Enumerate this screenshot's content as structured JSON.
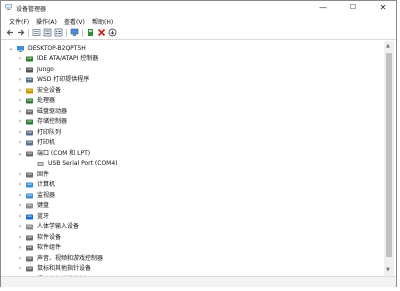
{
  "window": {
    "title": "设备管理器",
    "controls": {
      "minimize": "—",
      "maximize": "☐",
      "close": "✕"
    }
  },
  "menu": [
    "文件(F)",
    "操作(A)",
    "查看(V)",
    "帮助(H)"
  ],
  "colors": {
    "accent": "#0a64ad",
    "selection": "#cce8ff"
  },
  "tree": {
    "root": "DESKTOP-B2QPT5H",
    "items": [
      {
        "label": "IDE ATA/ATAPI 控制器",
        "icon": "ide-controller-icon",
        "color": "#2e7d32"
      },
      {
        "label": "Jungo",
        "icon": "usb-device-icon",
        "color": "#555555"
      },
      {
        "label": "WSD 打印提供程序",
        "icon": "printer-icon",
        "color": "#5a6f8a"
      },
      {
        "label": "安全设备",
        "icon": "security-icon",
        "color": "#c79a00"
      },
      {
        "label": "处理器",
        "icon": "processor-icon",
        "color": "#3a7d3a"
      },
      {
        "label": "磁盘驱动器",
        "icon": "disk-drive-icon",
        "color": "#6d6d6d"
      },
      {
        "label": "存储控制器",
        "icon": "storage-controller-icon",
        "color": "#2e7d32"
      },
      {
        "label": "打印队列",
        "icon": "print-queue-icon",
        "color": "#5a6f8a"
      },
      {
        "label": "打印机",
        "icon": "printer-icon",
        "color": "#5a6f8a"
      },
      {
        "label": "端口 (COM 和 LPT)",
        "icon": "port-icon",
        "color": "#6d6d6d",
        "expanded": true,
        "children": [
          "USB Serial Port (COM4)"
        ]
      },
      {
        "label": "固件",
        "icon": "firmware-icon",
        "color": "#6d6d6d"
      },
      {
        "label": "计算机",
        "icon": "computer-icon",
        "color": "#3a8fd6"
      },
      {
        "label": "监视器",
        "icon": "monitor-icon",
        "color": "#3a8fd6"
      },
      {
        "label": "键盘",
        "icon": "keyboard-icon",
        "color": "#8a8a8a"
      },
      {
        "label": "蓝牙",
        "icon": "bluetooth-icon",
        "color": "#1e6fd0"
      },
      {
        "label": "人体学输入设备",
        "icon": "hid-icon",
        "color": "#8a8a8a"
      },
      {
        "label": "软件设备",
        "icon": "software-device-icon",
        "color": "#6d6d6d"
      },
      {
        "label": "软件组件",
        "icon": "software-component-icon",
        "color": "#6d6d6d"
      },
      {
        "label": "声音、视频和游戏控制器",
        "icon": "audio-icon",
        "color": "#6d6d6d"
      },
      {
        "label": "鼠标和其他指针设备",
        "icon": "mouse-icon",
        "color": "#6d6d6d"
      },
      {
        "label": "通用串行总线控制器",
        "icon": "usb-controller-icon",
        "color": "#6d6d6d"
      }
    ]
  }
}
